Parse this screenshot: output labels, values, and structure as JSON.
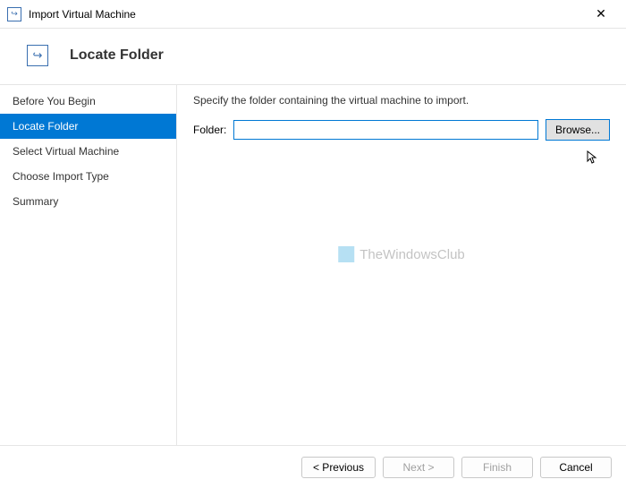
{
  "window": {
    "title": "Import Virtual Machine"
  },
  "header": {
    "title": "Locate Folder"
  },
  "sidebar": {
    "steps": [
      {
        "label": "Before You Begin"
      },
      {
        "label": "Locate Folder"
      },
      {
        "label": "Select Virtual Machine"
      },
      {
        "label": "Choose Import Type"
      },
      {
        "label": "Summary"
      }
    ]
  },
  "content": {
    "instruction": "Specify the folder containing the virtual machine to import.",
    "folder_label": "Folder:",
    "folder_value": "",
    "browse_label": "Browse..."
  },
  "watermark": {
    "text": "TheWindowsClub"
  },
  "footer": {
    "previous": "< Previous",
    "next": "Next >",
    "finish": "Finish",
    "cancel": "Cancel"
  }
}
